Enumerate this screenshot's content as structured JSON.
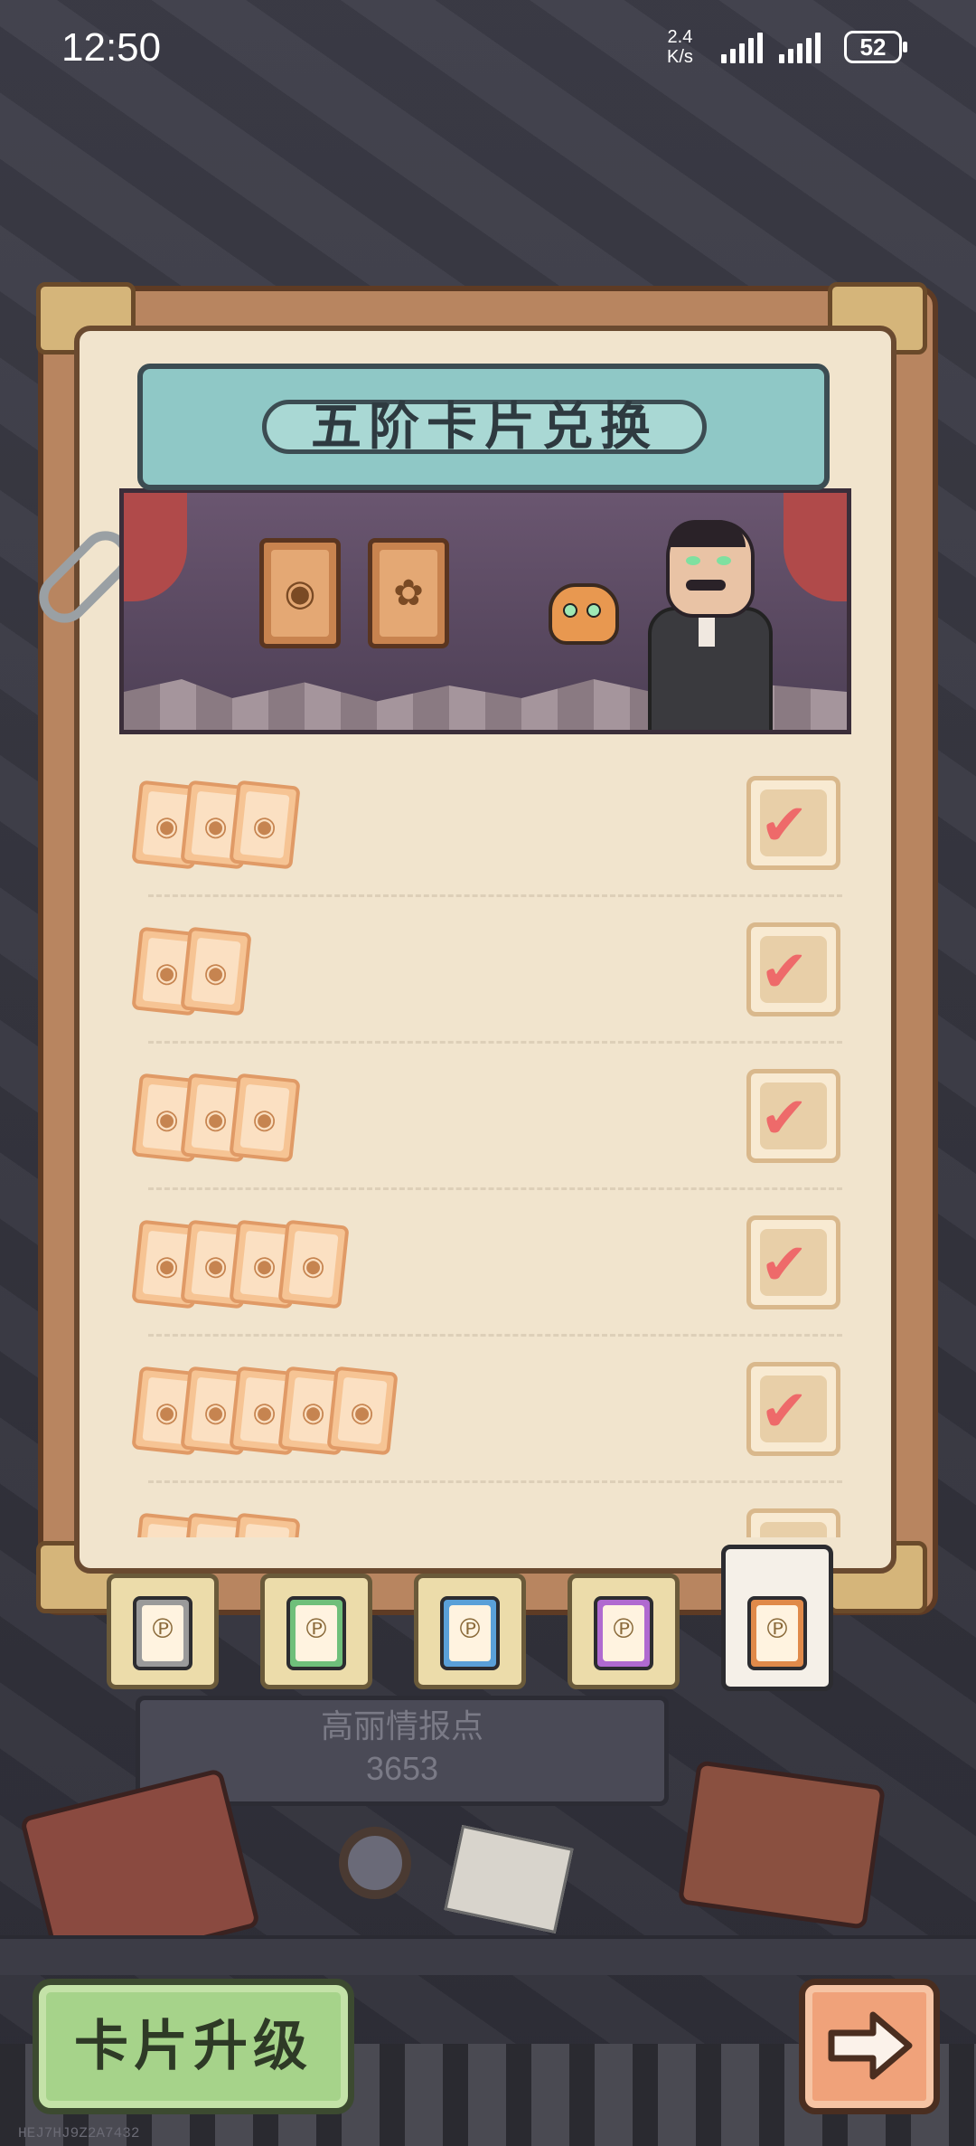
{
  "status_bar": {
    "time": "12:50",
    "net_speed_value": "2.4",
    "net_speed_unit": "K/s",
    "battery": "52"
  },
  "panel": {
    "title": "五阶卡片兑换"
  },
  "exchange_rows": [
    {
      "card_count": 3,
      "reward_icon": "hat-icon",
      "claimed": true
    },
    {
      "card_count": 2,
      "reward_icon": "envelope-icon",
      "claimed": true
    },
    {
      "card_count": 3,
      "reward_icon": "ornament-icon",
      "claimed": true
    },
    {
      "card_count": 4,
      "reward_icon": "cap-icon",
      "claimed": true
    },
    {
      "card_count": 5,
      "reward_icon": "rope-icon",
      "claimed": true
    },
    {
      "card_count": 3,
      "reward_icon": "coin-icon",
      "claimed": true
    }
  ],
  "tier_tabs": [
    {
      "tier": 1,
      "color": "#9a9a9a",
      "active": false
    },
    {
      "tier": 2,
      "color": "#6fbf7a",
      "active": false
    },
    {
      "tier": 3,
      "color": "#5aa0d8",
      "active": false
    },
    {
      "tier": 4,
      "color": "#b06ad0",
      "active": false
    },
    {
      "tier": 5,
      "color": "#e08a4a",
      "active": true
    }
  ],
  "info": {
    "label": "高丽情报点",
    "value": "3653"
  },
  "buttons": {
    "upgrade_label": "卡片升级",
    "next_icon": "arrow-right-icon"
  },
  "footer": {
    "code": "HEJ7HJ9Z2A7432"
  },
  "colors": {
    "banner": "#8fc8c6",
    "paper": "#f1e4cd",
    "check": "#ee6a6a",
    "upgrade_button": "#a6d38a",
    "next_button": "#f0a27a"
  }
}
